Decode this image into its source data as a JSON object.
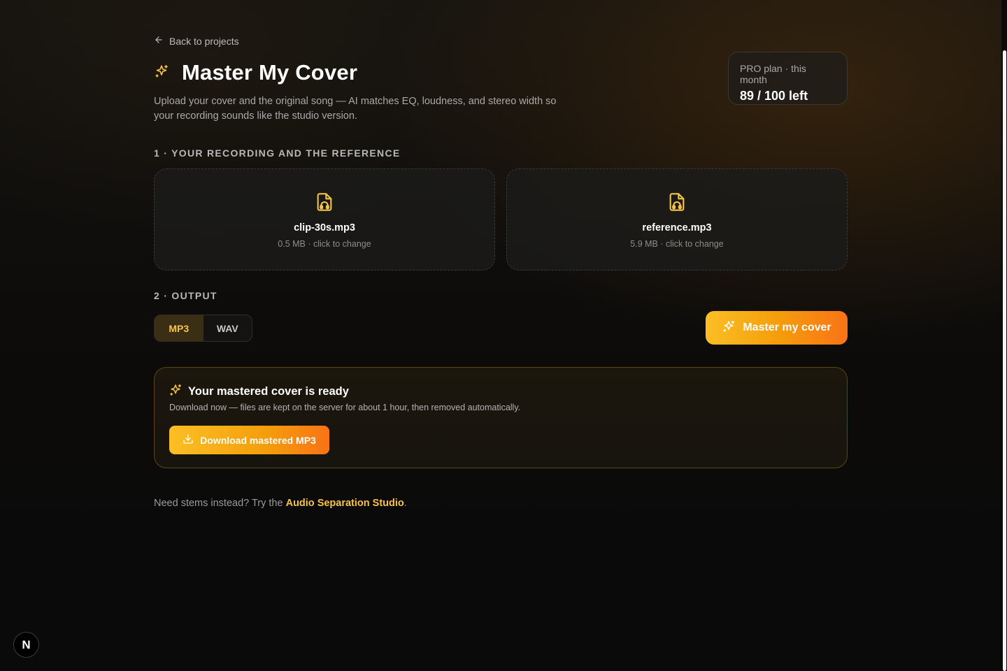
{
  "nav": {
    "back_label": "Back to projects"
  },
  "header": {
    "title": "Master My Cover",
    "subtitle": "Upload your cover and the original song — AI matches EQ, loudness, and stereo width so your recording sounds like the studio version."
  },
  "plan": {
    "label": "PRO plan · this month",
    "count": "89 / 100 left"
  },
  "section1": {
    "label": "1 · YOUR RECORDING AND THE REFERENCE",
    "recording": {
      "file_name": "clip-30s.mp3",
      "meta": "0.5 MB · click to change"
    },
    "reference": {
      "file_name": "reference.mp3",
      "meta": "5.9 MB · click to change"
    }
  },
  "section2": {
    "label": "2 · OUTPUT",
    "formats": [
      {
        "label": "MP3",
        "active": true
      },
      {
        "label": "WAV",
        "active": false
      }
    ],
    "master_button": "Master my cover"
  },
  "result": {
    "title": "Your mastered cover is ready",
    "description": "Download now — files are kept on the server for about 1 hour, then removed automatically.",
    "download_button": "Download mastered MP3"
  },
  "footer": {
    "prefix": "Need stems instead? Try the ",
    "link": "Audio Separation Studio",
    "suffix": "."
  },
  "badge": {
    "letter": "N"
  },
  "colors": {
    "accent": "#f7c447",
    "gradient_start": "#fbbf24",
    "gradient_end": "#f97316"
  },
  "icons": {
    "back": "arrow-left-icon",
    "title": "sparkles-icon",
    "file": "file-audio-icon",
    "master": "sparkles-icon",
    "download": "download-icon"
  }
}
